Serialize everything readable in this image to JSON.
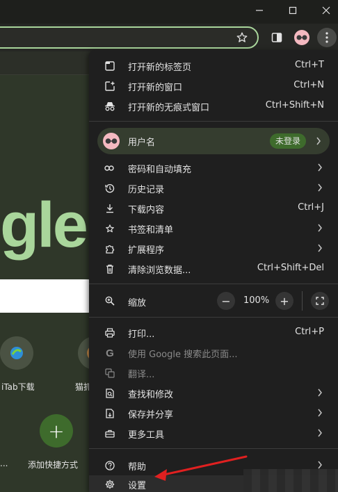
{
  "window": {
    "controls": {
      "minimize": "—",
      "maximize": "☐",
      "close": "✕"
    }
  },
  "toolbar": {
    "bookmark_star_icon": "star-icon",
    "sidebar_icon": "side-panel-icon",
    "menu_icon": "three-dots-vertical-icon"
  },
  "ntp": {
    "logo_text": "gle",
    "tiles": [
      {
        "label": "iTab下载",
        "icon": "itab-logo-icon"
      },
      {
        "label": "猫抓",
        "icon": "cat-extension-icon"
      },
      {
        "label": "...",
        "icon": ""
      },
      {
        "label": "添加快捷方式",
        "icon": "plus-icon",
        "glyph": "+"
      }
    ]
  },
  "menu": {
    "items_top": [
      {
        "label": "打开新的标签页",
        "shortcut": "Ctrl+T",
        "icon": "new-tab-icon"
      },
      {
        "label": "打开新的窗口",
        "shortcut": "Ctrl+N",
        "icon": "new-window-icon"
      },
      {
        "label": "打开新的无痕式窗口",
        "shortcut": "Ctrl+Shift+N",
        "icon": "incognito-icon"
      }
    ],
    "profile": {
      "name": "用户名",
      "status": "未登录",
      "icon": "avatar-icon"
    },
    "items_mid": [
      {
        "label": "密码和自动填充",
        "shortcut": "",
        "arrow": true,
        "icon": "key-icon"
      },
      {
        "label": "历史记录",
        "shortcut": "",
        "arrow": true,
        "icon": "history-icon"
      },
      {
        "label": "下载内容",
        "shortcut": "Ctrl+J",
        "arrow": false,
        "icon": "download-icon"
      },
      {
        "label": "书签和清单",
        "shortcut": "",
        "arrow": true,
        "icon": "star-icon"
      },
      {
        "label": "扩展程序",
        "shortcut": "",
        "arrow": true,
        "icon": "puzzle-icon"
      },
      {
        "label": "清除浏览数据...",
        "shortcut": "Ctrl+Shift+Del",
        "arrow": false,
        "icon": "trash-icon"
      }
    ],
    "zoom": {
      "label": "缩放",
      "value": "100%",
      "minus": "−",
      "plus": "+",
      "icon": "zoom-icon",
      "fullscreen_icon": "fullscreen-icon"
    },
    "items_bottom": [
      {
        "label": "打印...",
        "shortcut": "Ctrl+P",
        "arrow": false,
        "disabled": false,
        "icon": "print-icon"
      },
      {
        "label": "使用 Google 搜索此页面...",
        "shortcut": "",
        "arrow": false,
        "disabled": true,
        "icon": "google-g-icon"
      },
      {
        "label": "翻译...",
        "shortcut": "",
        "arrow": false,
        "disabled": true,
        "icon": "translate-icon"
      },
      {
        "label": "查找和修改",
        "shortcut": "",
        "arrow": true,
        "disabled": false,
        "icon": "find-icon"
      },
      {
        "label": "保存并分享",
        "shortcut": "",
        "arrow": true,
        "disabled": false,
        "icon": "save-share-icon"
      },
      {
        "label": "更多工具",
        "shortcut": "",
        "arrow": true,
        "disabled": false,
        "icon": "toolbox-icon"
      }
    ],
    "items_last": [
      {
        "label": "帮助",
        "shortcut": "",
        "arrow": true,
        "icon": "help-icon"
      },
      {
        "label": "设置",
        "shortcut": "",
        "arrow": false,
        "icon": "settings-gear-icon"
      }
    ]
  },
  "colors": {
    "accent_green": "#a9d69b",
    "menu_bg": "#1f1f1f",
    "annotation_red": "#e02020"
  }
}
